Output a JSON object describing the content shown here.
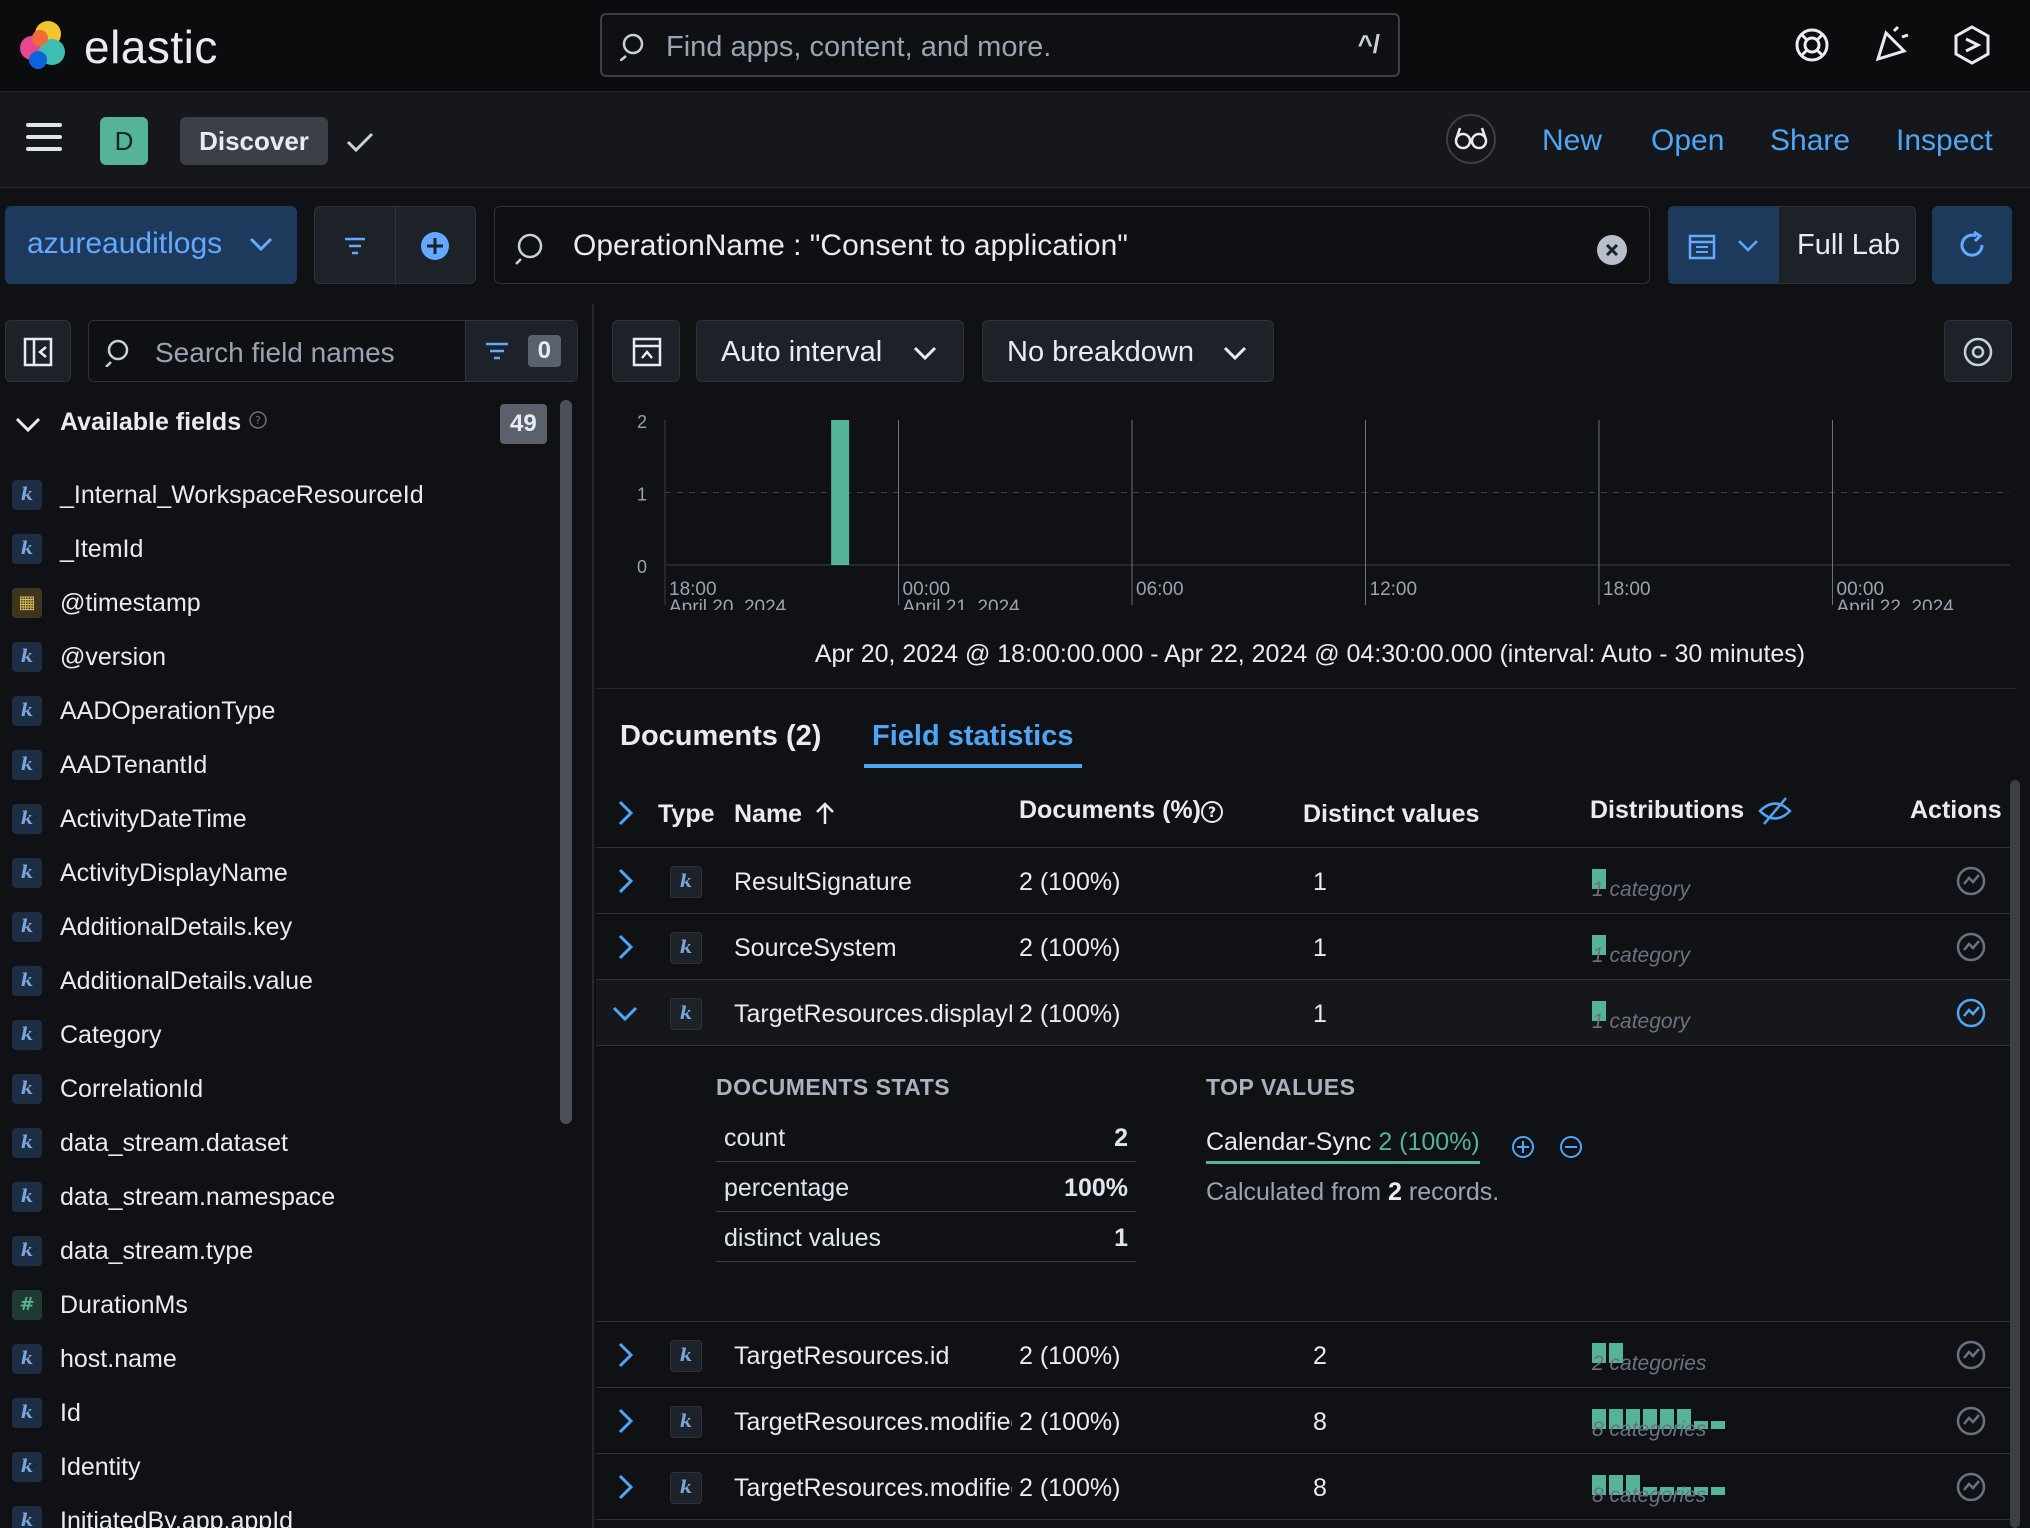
{
  "header": {
    "logo_text": "elastic",
    "search_placeholder": "Find apps, content, and more.",
    "search_shortcut": "^/"
  },
  "appbar": {
    "space_initial": "D",
    "app_name": "Discover",
    "links": [
      "New",
      "Open",
      "Share",
      "Inspect"
    ]
  },
  "querybar": {
    "data_view": "azureauditlogs",
    "query": "OperationName : \"Consent to application\"",
    "date_label": "Full Lab"
  },
  "sidebar": {
    "search_placeholder": "Search field names",
    "filter_count": "0",
    "available_title": "Available fields",
    "available_count": "49",
    "fields": [
      {
        "type": "k",
        "name": "_Internal_WorkspaceResourceId"
      },
      {
        "type": "k",
        "name": "_ItemId"
      },
      {
        "type": "date",
        "name": "@timestamp"
      },
      {
        "type": "k",
        "name": "@version"
      },
      {
        "type": "k",
        "name": "AADOperationType"
      },
      {
        "type": "k",
        "name": "AADTenantId"
      },
      {
        "type": "k",
        "name": "ActivityDateTime"
      },
      {
        "type": "k",
        "name": "ActivityDisplayName"
      },
      {
        "type": "k",
        "name": "AdditionalDetails.key"
      },
      {
        "type": "k",
        "name": "AdditionalDetails.value"
      },
      {
        "type": "k",
        "name": "Category"
      },
      {
        "type": "k",
        "name": "CorrelationId"
      },
      {
        "type": "k",
        "name": "data_stream.dataset"
      },
      {
        "type": "k",
        "name": "data_stream.namespace"
      },
      {
        "type": "k",
        "name": "data_stream.type"
      },
      {
        "type": "num",
        "name": "DurationMs"
      },
      {
        "type": "k",
        "name": "host.name"
      },
      {
        "type": "k",
        "name": "Id"
      },
      {
        "type": "k",
        "name": "Identity"
      },
      {
        "type": "k",
        "name": "InitiatedBy.app.appId"
      }
    ]
  },
  "histogram": {
    "interval_label": "Auto interval",
    "breakdown_label": "No breakdown",
    "time_range": "Apr 20, 2024 @ 18:00:00.000 - Apr 22, 2024 @ 04:30:00.000 (interval: Auto - 30 minutes)"
  },
  "chart_data": {
    "type": "bar",
    "y_ticks": [
      "2",
      "1",
      "0"
    ],
    "ylim": [
      0,
      2
    ],
    "x_ticks": [
      {
        "label": "18:00",
        "sub": "April 20, 2024"
      },
      {
        "label": "00:00",
        "sub": "April 21, 2024"
      },
      {
        "label": "06:00",
        "sub": ""
      },
      {
        "label": "12:00",
        "sub": ""
      },
      {
        "label": "18:00",
        "sub": ""
      },
      {
        "label": "00:00",
        "sub": "April 22, 2024"
      }
    ],
    "bars": [
      {
        "x": "Apr 20, 2024 22:30",
        "value": 2
      }
    ],
    "color": "#54b399",
    "grid": true
  },
  "tabs": {
    "documents": "Documents (2)",
    "field_stats": "Field statistics"
  },
  "table": {
    "headers": {
      "type": "Type",
      "name": "Name",
      "documents": "Documents (%)",
      "distinct": "Distinct values",
      "distributions": "Distributions",
      "actions": "Actions"
    },
    "rows_top": [
      {
        "name": "ResultSignature",
        "docs": "2 (100%)",
        "distinct": "1",
        "dist_label": "1 category",
        "bars": [
          1
        ]
      },
      {
        "name": "SourceSystem",
        "docs": "2 (100%)",
        "distinct": "1",
        "dist_label": "1 category",
        "bars": [
          1
        ]
      },
      {
        "name": "TargetResources.displayName",
        "docs": "2 (100%)",
        "distinct": "1",
        "dist_label": "1 category",
        "bars": [
          1
        ]
      }
    ],
    "expanded": {
      "stats_title": "DOCUMENTS STATS",
      "stats": [
        {
          "k": "count",
          "v": "2"
        },
        {
          "k": "percentage",
          "v": "100%"
        },
        {
          "k": "distinct values",
          "v": "1"
        }
      ],
      "top_title": "TOP VALUES",
      "top_value": "Calendar-Sync",
      "top_value_pct": "2 (100%)",
      "note_prefix": "Calculated from ",
      "note_count": "2",
      "note_suffix": " records."
    },
    "rows_bottom": [
      {
        "name": "TargetResources.id",
        "docs": "2 (100%)",
        "distinct": "2",
        "dist_label": "2 categories",
        "bars": [
          1,
          1
        ]
      },
      {
        "name": "TargetResources.modifiedProperties.displayName",
        "docs": "2 (100%)",
        "distinct": "8",
        "dist_label": "8 categories",
        "bars": [
          1,
          1,
          1,
          1,
          1,
          1,
          0.4,
          0.4
        ]
      },
      {
        "name": "TargetResources.modifiedProperties.newValue",
        "docs": "2 (100%)",
        "distinct": "8",
        "dist_label": "8 categories",
        "bars": [
          1,
          1,
          1,
          0.4,
          0.4,
          0.4,
          0.4,
          0.4
        ]
      }
    ]
  }
}
